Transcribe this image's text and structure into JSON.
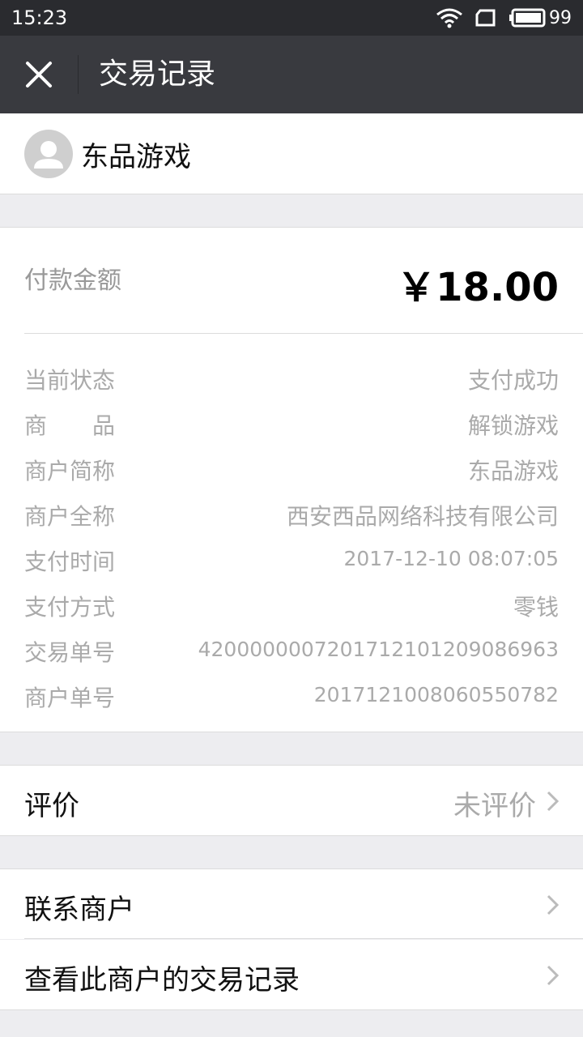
{
  "status_bar": {
    "time": "15:23",
    "battery": "99"
  },
  "title_bar": {
    "title": "交易记录"
  },
  "merchant": {
    "name": "东品游戏"
  },
  "payment": {
    "amount_label": "付款金额",
    "amount": "￥18.00",
    "rows": [
      {
        "label": "当前状态",
        "value": "支付成功"
      },
      {
        "label": "商　　品",
        "value": "解锁游戏"
      },
      {
        "label": "商户简称",
        "value": "东品游戏"
      },
      {
        "label": "商户全称",
        "value": "西安西品网络科技有限公司"
      },
      {
        "label": "支付时间",
        "value": "2017-12-10 08:07:05"
      },
      {
        "label": "支付方式",
        "value": "零钱"
      },
      {
        "label": "交易单号",
        "value": "4200000007201712101209086963"
      },
      {
        "label": "商户单号",
        "value": "20171210080605507​82"
      }
    ]
  },
  "review": {
    "label": "评价",
    "value": "未评价"
  },
  "actions": {
    "contact": "联系商户",
    "history": "查看此商户的交易记录"
  },
  "colors": {
    "header": "#393a3f",
    "statusbar": "#2a2b2f",
    "background": "#ededf0"
  }
}
